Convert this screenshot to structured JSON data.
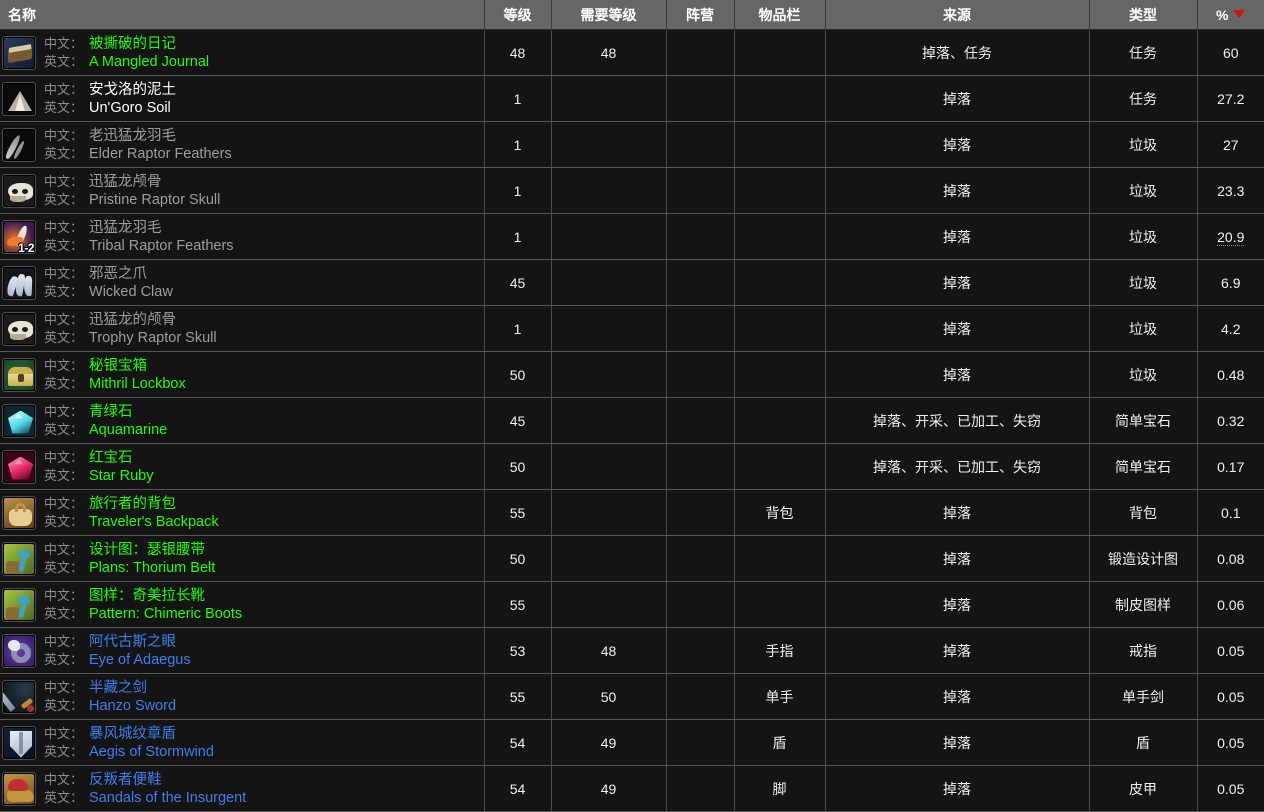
{
  "table": {
    "columns": [
      {
        "key": "name",
        "label": "名称",
        "name": "column-header-name",
        "sorted": false
      },
      {
        "key": "level",
        "label": "等级",
        "name": "column-header-level",
        "sorted": false
      },
      {
        "key": "req",
        "label": "需要等级",
        "name": "column-header-req-level",
        "sorted": false
      },
      {
        "key": "faction",
        "label": "阵营",
        "name": "column-header-faction",
        "sorted": false
      },
      {
        "key": "slot",
        "label": "物品栏",
        "name": "column-header-slot",
        "sorted": false
      },
      {
        "key": "source",
        "label": "来源",
        "name": "column-header-source",
        "sorted": false
      },
      {
        "key": "type",
        "label": "类型",
        "name": "column-header-type",
        "sorted": false
      },
      {
        "key": "pct",
        "label": "%",
        "name": "column-header-percent",
        "sorted": true
      }
    ],
    "sort": {
      "column": "%",
      "direction": "desc",
      "caret_color": "#cc1414"
    },
    "labels": {
      "zh": "中文：",
      "en": "英文："
    },
    "quality_colors": {
      "junk": "#9d9d9d",
      "common": "#ffffff",
      "uncommon": "#1eff00",
      "rare": "#3e7fec"
    },
    "rows": [
      {
        "zh": "被撕破的日记",
        "en": "A Mangled Journal",
        "quality": "uncommon",
        "level": "48",
        "req": "48",
        "faction": "",
        "slot": "",
        "source": "掉落、任务",
        "type": "任务",
        "pct": "60",
        "icon": {
          "name": "icon-book-journal",
          "colors": [
            "#2a3d5e",
            "#7a5a34",
            "#d8c9a8"
          ],
          "shape": "book",
          "stack": ""
        }
      },
      {
        "zh": "安戈洛的泥土",
        "en": "Un'Goro Soil",
        "quality": "common",
        "level": "1",
        "req": "",
        "faction": "",
        "slot": "",
        "source": "掉落",
        "type": "任务",
        "pct": "27.2",
        "icon": {
          "name": "icon-soil-pile",
          "colors": [
            "#0b0b0b",
            "#b9b2a4",
            "#efeae0"
          ],
          "shape": "mound",
          "stack": ""
        }
      },
      {
        "zh": "老迅猛龙羽毛",
        "en": "Elder Raptor Feathers",
        "quality": "junk",
        "level": "1",
        "req": "",
        "faction": "",
        "slot": "",
        "source": "掉落",
        "type": "垃圾",
        "pct": "27",
        "icon": {
          "name": "icon-feather-dark",
          "colors": [
            "#0a0a0a",
            "#cfcfcf",
            "#8f8f8f"
          ],
          "shape": "feather",
          "stack": ""
        }
      },
      {
        "zh": "迅猛龙颅骨",
        "en": "Pristine Raptor Skull",
        "quality": "junk",
        "level": "1",
        "req": "",
        "faction": "",
        "slot": "",
        "source": "掉落",
        "type": "垃圾",
        "pct": "23.3",
        "icon": {
          "name": "icon-raptor-skull",
          "colors": [
            "#1a1a18",
            "#e7e3d6",
            "#b2ab96"
          ],
          "shape": "skull",
          "stack": ""
        }
      },
      {
        "zh": "迅猛龙羽毛",
        "en": "Tribal Raptor Feathers",
        "quality": "junk",
        "level": "1",
        "req": "",
        "faction": "",
        "slot": "",
        "source": "掉落",
        "type": "垃圾",
        "pct": "20.9",
        "pct_dotted": true,
        "icon": {
          "name": "icon-feather-tribal",
          "colors": [
            "#3b1a52",
            "#f07b2a",
            "#f4ece0"
          ],
          "shape": "feather-orange",
          "stack": "1-2"
        }
      },
      {
        "zh": "邪恶之爪",
        "en": "Wicked Claw",
        "quality": "junk",
        "level": "45",
        "req": "",
        "faction": "",
        "slot": "",
        "source": "掉落",
        "type": "垃圾",
        "pct": "6.9",
        "icon": {
          "name": "icon-claw",
          "colors": [
            "#14161c",
            "#aab6cc",
            "#e3e9f5"
          ],
          "shape": "claw",
          "stack": ""
        }
      },
      {
        "zh": "迅猛龙的颅骨",
        "en": "Trophy Raptor Skull",
        "quality": "junk",
        "level": "1",
        "req": "",
        "faction": "",
        "slot": "",
        "source": "掉落",
        "type": "垃圾",
        "pct": "4.2",
        "icon": {
          "name": "icon-raptor-skull-trophy",
          "colors": [
            "#1a1a18",
            "#e7e3d6",
            "#b2ab96"
          ],
          "shape": "skull",
          "stack": ""
        }
      },
      {
        "zh": "秘银宝箱",
        "en": "Mithril Lockbox",
        "quality": "uncommon",
        "level": "50",
        "req": "",
        "faction": "",
        "slot": "",
        "source": "掉落",
        "type": "垃圾",
        "pct": "0.48",
        "icon": {
          "name": "icon-lockbox",
          "colors": [
            "#1d4a2c",
            "#c9b24e",
            "#efe0a0"
          ],
          "shape": "chest",
          "stack": ""
        }
      },
      {
        "zh": "青绿石",
        "en": "Aquamarine",
        "quality": "uncommon",
        "level": "45",
        "req": "",
        "faction": "",
        "slot": "",
        "source": "掉落、开采、已加工、失窃",
        "type": "简单宝石",
        "pct": "0.32",
        "icon": {
          "name": "icon-gem-aquamarine",
          "colors": [
            "#0d2730",
            "#4fd7e6",
            "#d6fbff"
          ],
          "shape": "gem",
          "stack": ""
        }
      },
      {
        "zh": "红宝石",
        "en": "Star Ruby",
        "quality": "uncommon",
        "level": "50",
        "req": "",
        "faction": "",
        "slot": "",
        "source": "掉落、开采、已加工、失窃",
        "type": "简单宝石",
        "pct": "0.17",
        "icon": {
          "name": "icon-gem-star-ruby",
          "colors": [
            "#3a0418",
            "#e0245e",
            "#ff9ec4"
          ],
          "shape": "gem",
          "stack": ""
        }
      },
      {
        "zh": "旅行者的背包",
        "en": "Traveler's Backpack",
        "quality": "uncommon",
        "level": "55",
        "req": "",
        "faction": "",
        "slot": "背包",
        "source": "掉落",
        "type": "背包",
        "pct": "0.1",
        "icon": {
          "name": "icon-backpack",
          "colors": [
            "#5a3c19",
            "#c09247",
            "#e8cc93"
          ],
          "shape": "bag",
          "stack": ""
        }
      },
      {
        "zh": "设计图：瑟银腰带",
        "en": "Plans: Thorium Belt",
        "quality": "uncommon",
        "level": "50",
        "req": "",
        "faction": "",
        "slot": "",
        "source": "掉落",
        "type": "锻造设计图",
        "pct": "0.08",
        "icon": {
          "name": "icon-plans-scroll",
          "colors": [
            "#4e6b1b",
            "#a8c63e",
            "#3aa3c7"
          ],
          "shape": "plans",
          "stack": ""
        }
      },
      {
        "zh": "图样：奇美拉长靴",
        "en": "Pattern: Chimeric Boots",
        "quality": "uncommon",
        "level": "55",
        "req": "",
        "faction": "",
        "slot": "",
        "source": "掉落",
        "type": "制皮图样",
        "pct": "0.06",
        "icon": {
          "name": "icon-pattern-scroll",
          "colors": [
            "#4e6b1b",
            "#a8c63e",
            "#3aa3c7"
          ],
          "shape": "plans",
          "stack": ""
        }
      },
      {
        "zh": "阿代古斯之眼",
        "en": "Eye of Adaegus",
        "quality": "rare",
        "level": "53",
        "req": "48",
        "faction": "",
        "slot": "手指",
        "source": "掉落",
        "type": "戒指",
        "pct": "0.05",
        "icon": {
          "name": "icon-ring",
          "colors": [
            "#3a1f6e",
            "#8a8fb0",
            "#e6eaf5"
          ],
          "shape": "ring",
          "stack": ""
        }
      },
      {
        "zh": "半藏之剑",
        "en": "Hanzo Sword",
        "quality": "rare",
        "level": "55",
        "req": "50",
        "faction": "",
        "slot": "单手",
        "source": "掉落",
        "type": "单手剑",
        "pct": "0.05",
        "icon": {
          "name": "icon-sword",
          "colors": [
            "#101418",
            "#bcd0e4",
            "#c08a3a"
          ],
          "shape": "sword",
          "stack": ""
        }
      },
      {
        "zh": "暴风城纹章盾",
        "en": "Aegis of Stormwind",
        "quality": "rare",
        "level": "54",
        "req": "49",
        "faction": "",
        "slot": "盾",
        "source": "掉落",
        "type": "盾",
        "pct": "0.05",
        "icon": {
          "name": "icon-shield",
          "colors": [
            "#13233a",
            "#b9c4d4",
            "#e8eef7"
          ],
          "shape": "shield",
          "stack": ""
        }
      },
      {
        "zh": "反叛者便鞋",
        "en": "Sandals of the Insurgent",
        "quality": "rare",
        "level": "54",
        "req": "49",
        "faction": "",
        "slot": "脚",
        "source": "掉落",
        "type": "皮甲",
        "pct": "0.05",
        "icon": {
          "name": "icon-sandals",
          "colors": [
            "#6b4a24",
            "#c4953f",
            "#c03030"
          ],
          "shape": "boot",
          "stack": ""
        }
      }
    ]
  }
}
